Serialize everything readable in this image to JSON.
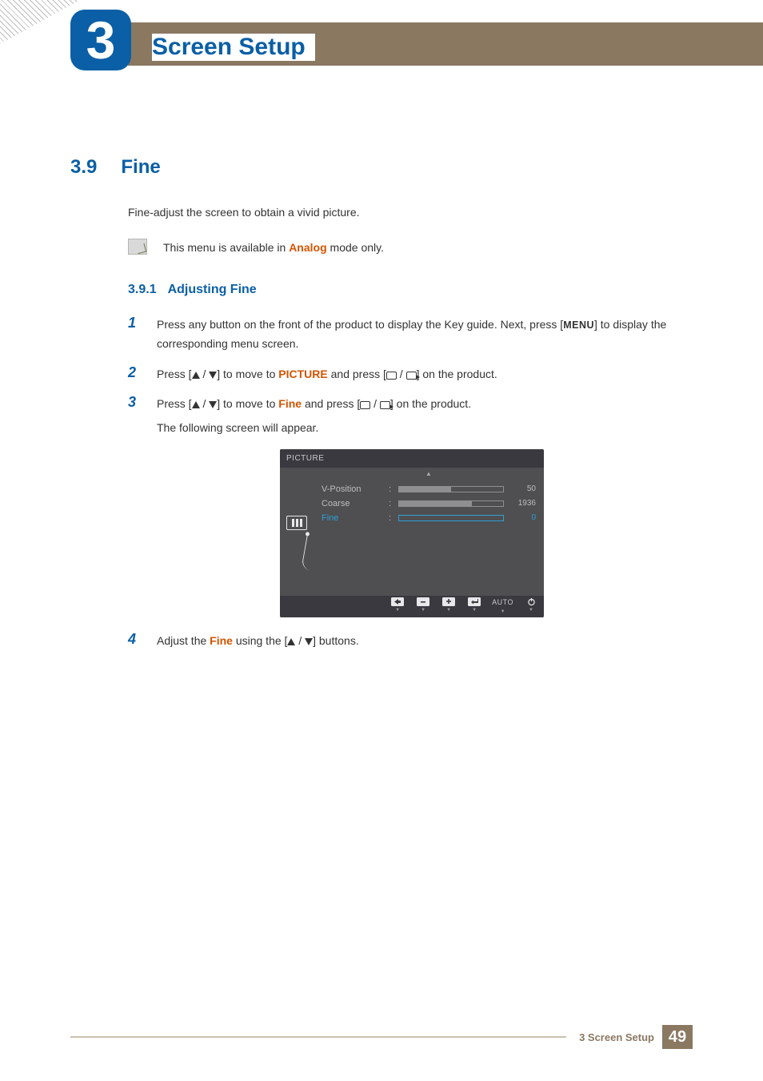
{
  "chapter": {
    "number": "3",
    "title": "Screen Setup"
  },
  "section": {
    "number": "3.9",
    "title": "Fine"
  },
  "intro": "Fine-adjust the screen to obtain a vivid picture.",
  "note": {
    "prefix": "This menu is available in ",
    "mode": "Analog",
    "suffix": " mode only."
  },
  "subsection": {
    "number": "3.9.1",
    "title": "Adjusting Fine"
  },
  "steps": {
    "s1": {
      "num": "1",
      "a": "Press any button on the front of the product to display the Key guide. Next, press [",
      "menu": "MENU",
      "b": "] to display the corresponding menu screen."
    },
    "s2": {
      "num": "2",
      "a": "Press [",
      "b": "] to move to ",
      "kw": "PICTURE",
      "c": " and press [",
      "d": "] on the product."
    },
    "s3": {
      "num": "3",
      "a": "Press [",
      "b": "] to move to ",
      "kw": "Fine",
      "c": " and press [",
      "d": "] on the product.",
      "extra": "The following screen will appear."
    },
    "s4": {
      "num": "4",
      "a": "Adjust the ",
      "kw": "Fine",
      "b": " using the [",
      "c": "] buttons."
    }
  },
  "osd": {
    "title": "PICTURE",
    "rows": {
      "r1": {
        "label": "V-Position",
        "value": "50",
        "fill": 50
      },
      "r2": {
        "label": "Coarse",
        "value": "1936",
        "fill": 70
      },
      "r3": {
        "label": "Fine",
        "value": "0",
        "fill": 0
      }
    },
    "footer": {
      "auto": "AUTO"
    }
  },
  "footer": {
    "label": "3 Screen Setup",
    "page": "49"
  }
}
